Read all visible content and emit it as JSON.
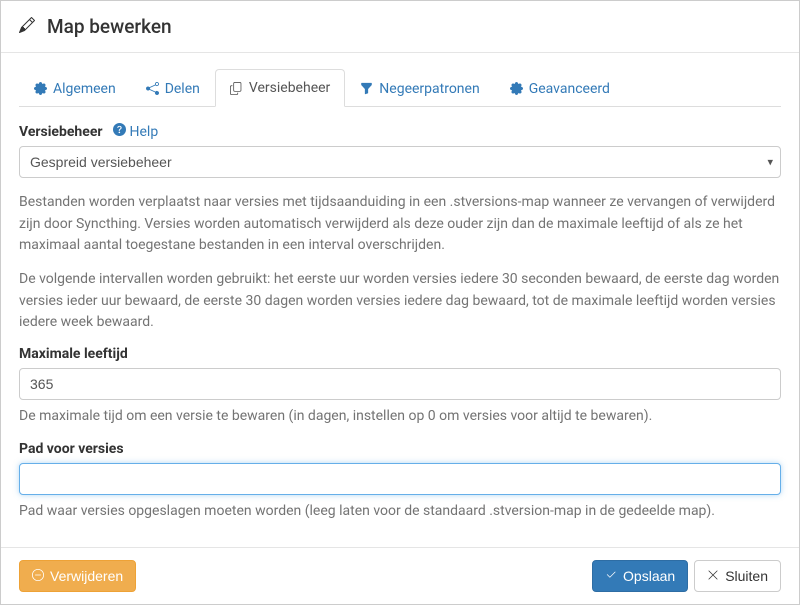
{
  "header": {
    "title": "Map bewerken"
  },
  "tabs": {
    "general": "Algemeen",
    "sharing": "Delen",
    "versioning": "Versiebeheer",
    "ignore": "Negeerpatronen",
    "advanced": "Geavanceerd"
  },
  "form": {
    "versioning_label": "Versiebeheer",
    "help_label": "Help",
    "versioning_select_value": "Gespreid versiebeheer",
    "description_1": "Bestanden worden verplaatst naar versies met tijdsaanduiding in een .stversions-map wanneer ze vervangen of verwijderd zijn door Syncthing. Versies worden automatisch verwijderd als deze ouder zijn dan de maximale leeftijd of als ze het maximaal aantal toegestane bestanden in een interval overschrijden.",
    "description_2": "De volgende intervallen worden gebruikt: het eerste uur worden versies iedere 30 seconden bewaard, de eerste dag worden versies ieder uur bewaard, de eerste 30 dagen worden versies iedere dag bewaard, tot de maximale leeftijd worden versies iedere week bewaard.",
    "max_age_label": "Maximale leeftijd",
    "max_age_value": "365",
    "max_age_help": "De maximale tijd om een versie te bewaren (in dagen, instellen op 0 om versies voor altijd te bewaren).",
    "versions_path_label": "Pad voor versies",
    "versions_path_value": "",
    "versions_path_help": "Pad waar versies opgeslagen moeten worden (leeg laten voor de standaard .stversion-map in de gedeelde map)."
  },
  "buttons": {
    "delete": "Verwijderen",
    "save": "Opslaan",
    "close": "Sluiten"
  }
}
